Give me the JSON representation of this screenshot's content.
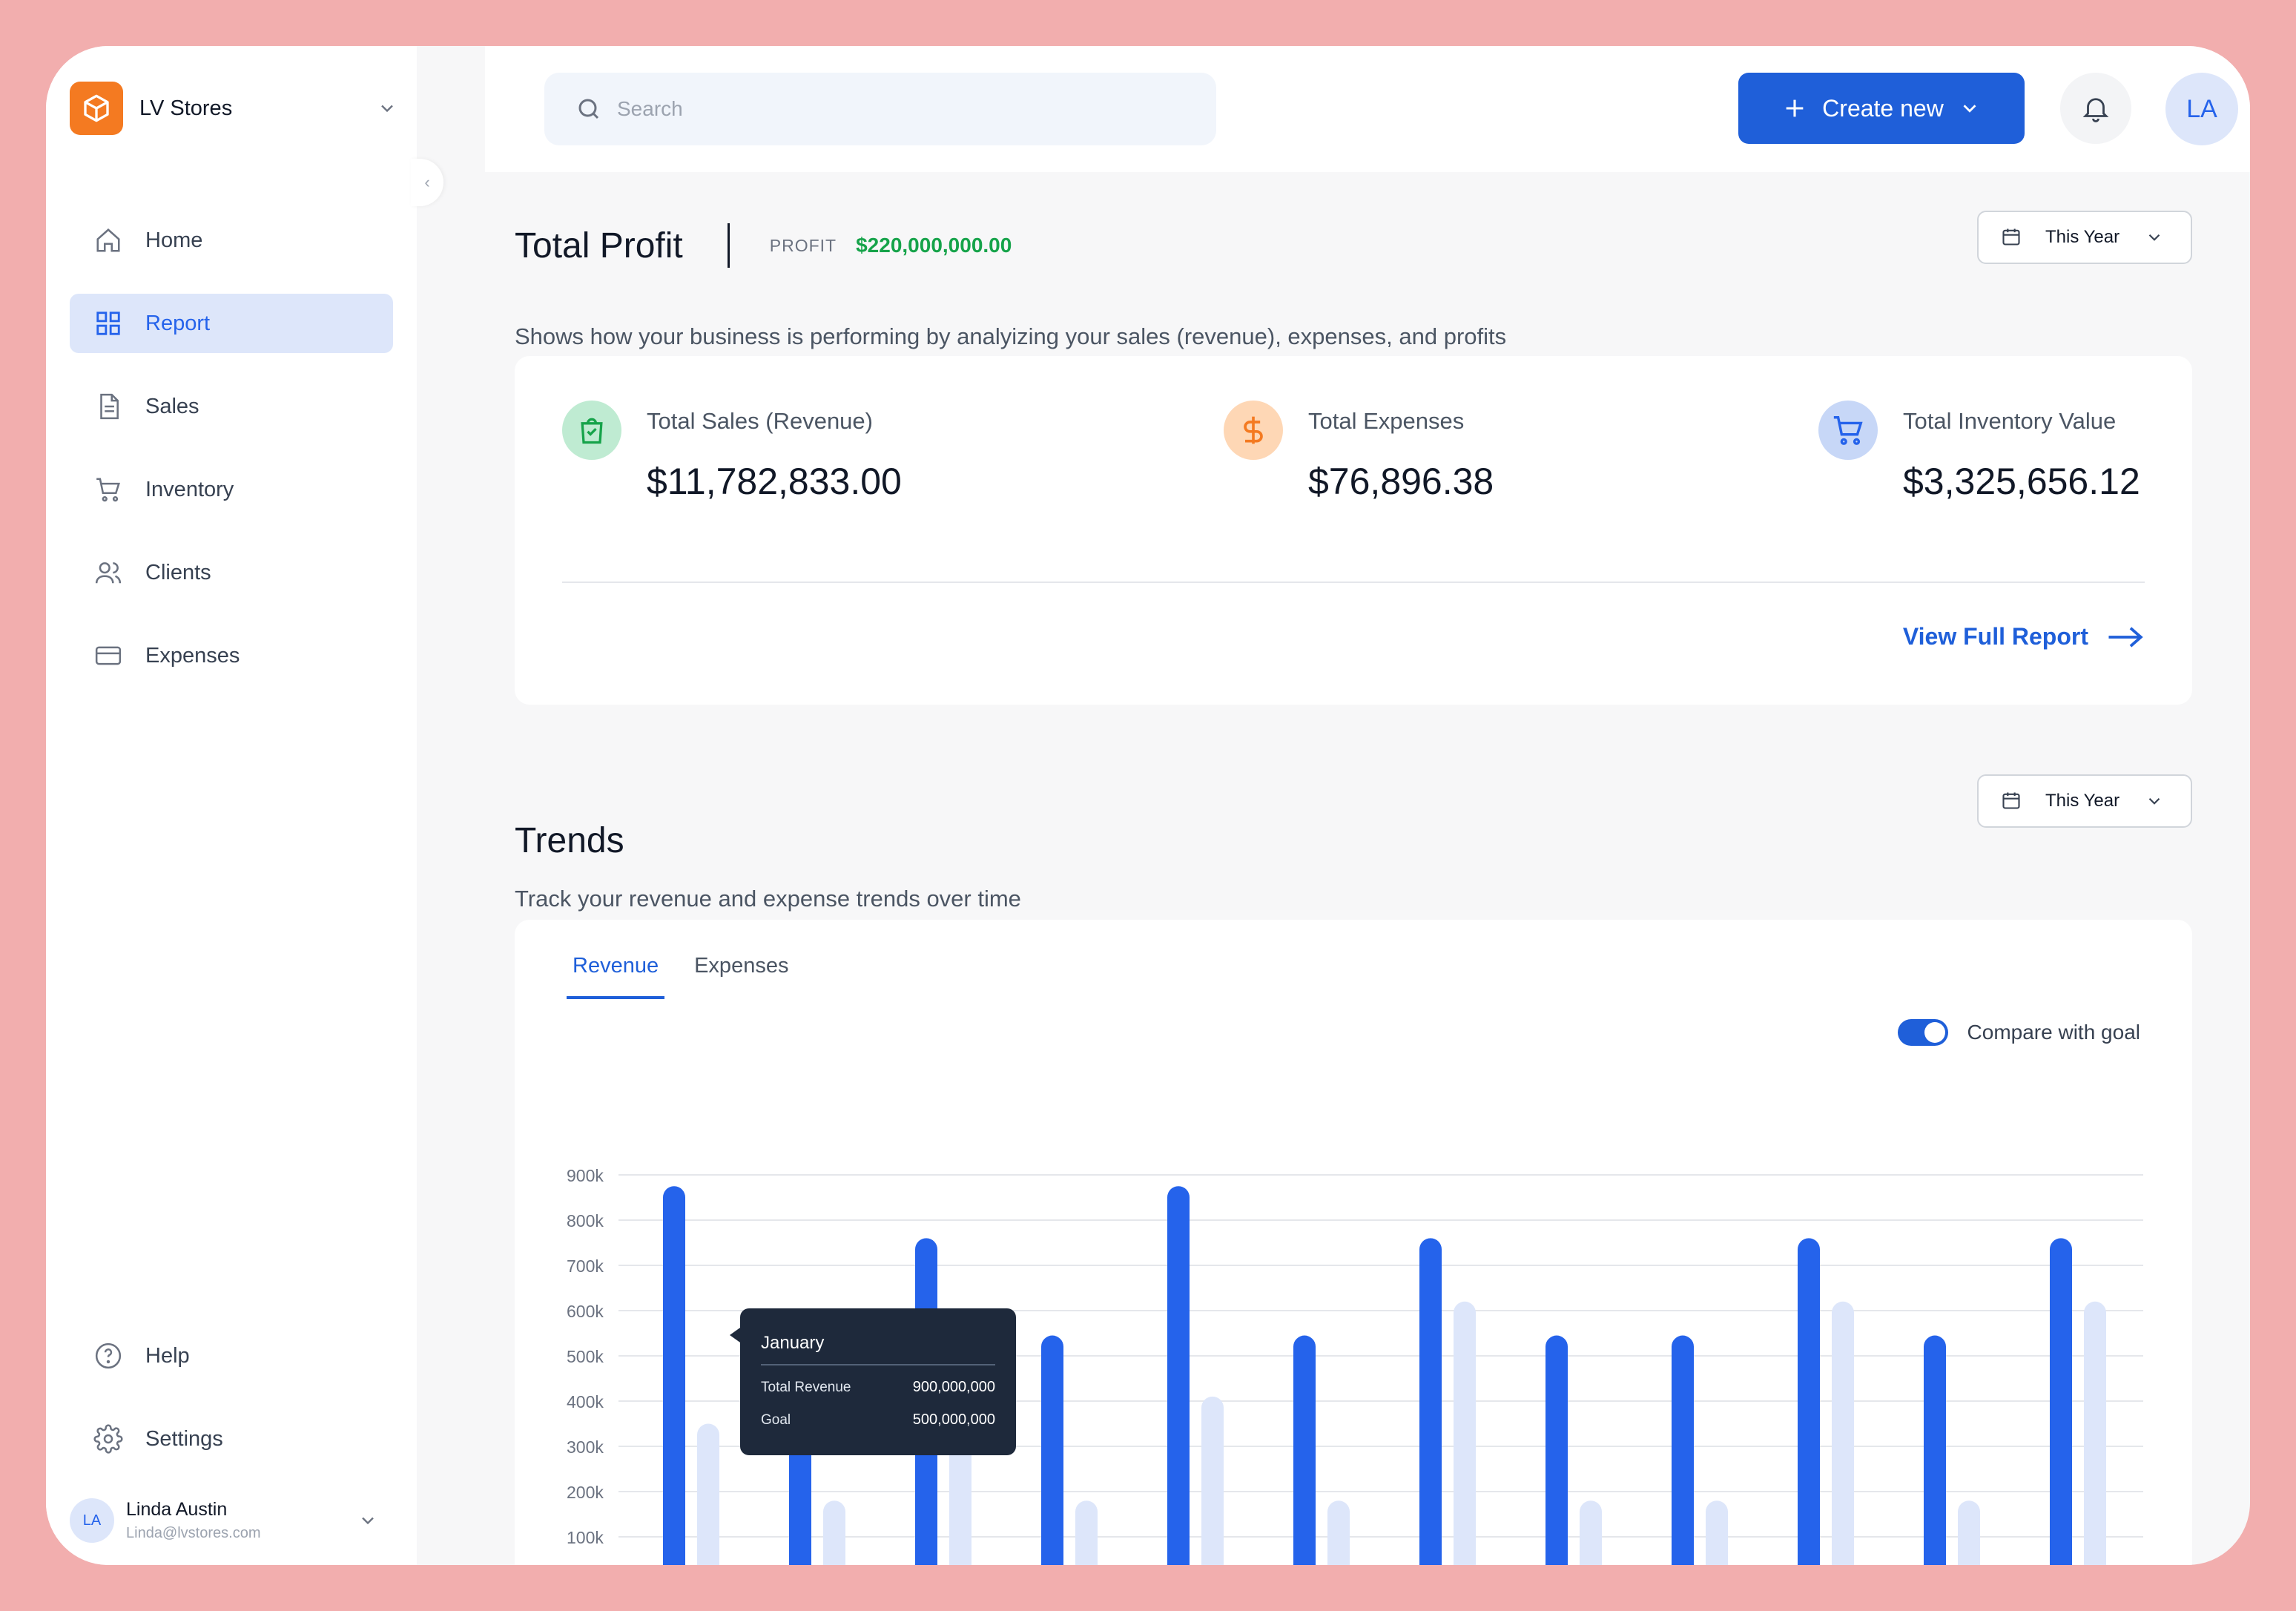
{
  "brand": {
    "name": "LV Stores",
    "logo_icon": "box-icon",
    "accent": "#F47A21"
  },
  "sidebar": {
    "items": [
      {
        "label": "Home",
        "icon": "home-icon"
      },
      {
        "label": "Report",
        "icon": "grid-icon",
        "active": true
      },
      {
        "label": "Sales",
        "icon": "document-icon"
      },
      {
        "label": "Inventory",
        "icon": "cart-icon"
      },
      {
        "label": "Clients",
        "icon": "users-icon"
      },
      {
        "label": "Expenses",
        "icon": "card-icon"
      }
    ],
    "bottom_items": [
      {
        "label": "Help",
        "icon": "help-icon"
      },
      {
        "label": "Settings",
        "icon": "gear-icon"
      }
    ],
    "user": {
      "initials": "LA",
      "name": "Linda Austin",
      "email": "Linda@lvstores.com"
    }
  },
  "header": {
    "search_placeholder": "Search",
    "create_label": "Create new",
    "avatar_initials": "LA",
    "primary_color": "#1F5FD9"
  },
  "profit": {
    "title": "Total Profit",
    "label": "PROFIT",
    "value": "$220,000,000.00",
    "description": "Shows how your business is performing by analyizing your sales (revenue), expenses, and profits",
    "period": "This Year",
    "stats": [
      {
        "label": "Total Sales (Revenue)",
        "value": "$11,782,833.00",
        "icon": "shopping-bag-icon",
        "color": "#16A34A"
      },
      {
        "label": "Total Expenses",
        "value": "$76,896.38",
        "icon": "dollar-icon",
        "color": "#F47A21"
      },
      {
        "label": "Total Inventory Value",
        "value": "$3,325,656.12",
        "icon": "cart-icon",
        "color": "#2563EB"
      }
    ],
    "view_report_label": "View Full Report"
  },
  "trends": {
    "title": "Trends",
    "description": "Track your revenue and expense trends over time",
    "period": "This Year",
    "tabs": [
      {
        "label": "Revenue",
        "active": true
      },
      {
        "label": "Expenses",
        "active": false
      }
    ],
    "compare_label": "Compare with goal",
    "compare_on": true
  },
  "chart_data": {
    "type": "bar",
    "y_ticks": [
      "900k",
      "800k",
      "700k",
      "600k",
      "500k",
      "400k",
      "300k",
      "200k",
      "100k"
    ],
    "ylim": [
      0,
      900000
    ],
    "series": [
      {
        "values": [
          875000,
          420000,
          760000,
          545000,
          875000,
          545000,
          760000,
          545000,
          545000,
          760000,
          545000,
          760000
        ],
        "color": "#2563EB"
      },
      {
        "values": [
          350000,
          180000,
          350000,
          180000,
          410000,
          180000,
          620000,
          180000,
          180000,
          620000,
          180000,
          620000
        ],
        "color": "#DDE6FA"
      }
    ],
    "tooltip": {
      "title": "January",
      "rows": [
        {
          "label": "Total Revenue",
          "value": "900,000,000"
        },
        {
          "label": "Goal",
          "value": "500,000,000"
        }
      ]
    }
  }
}
